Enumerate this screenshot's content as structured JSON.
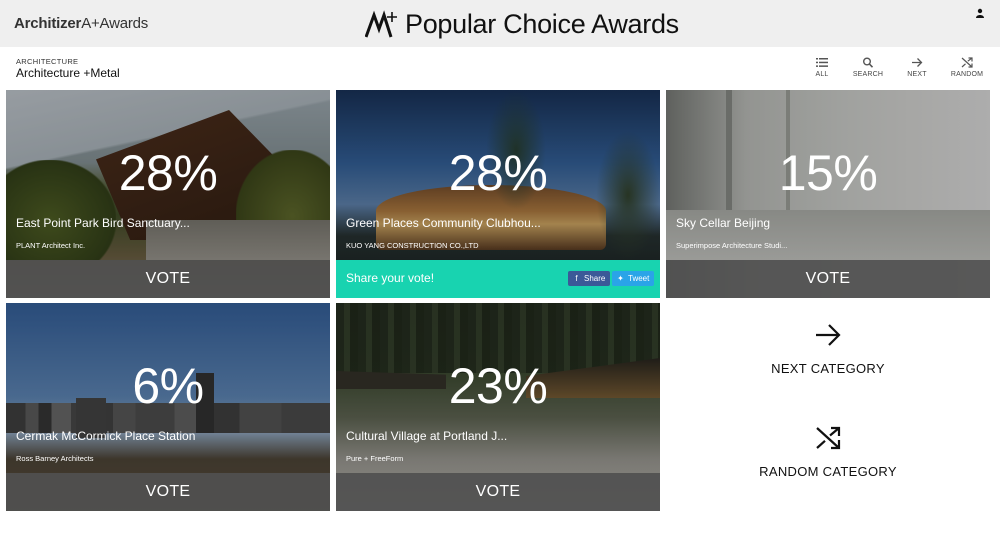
{
  "header": {
    "brand_wordmark": "Architizer",
    "brand_suffix": "A+Awards",
    "title_mark": "A+",
    "title": "Popular Choice Awards",
    "user_icon": "user-icon"
  },
  "breadcrumb": {
    "category_group": "ARCHITECTURE",
    "category": "Architecture +Metal"
  },
  "nav": {
    "all": "ALL",
    "search": "SEARCH",
    "next": "NEXT",
    "random": "RANDOM"
  },
  "projects": [
    {
      "percent": "28%",
      "name": "East Point Park Bird Sanctuary...",
      "firm": "PLANT Architect Inc.",
      "action": "VOTE"
    },
    {
      "percent": "28%",
      "name": "Green Places Community Clubhou...",
      "firm": "KUO YANG CONSTRUCTION CO.,LTD",
      "share_text": "Share your vote!",
      "share_fb": "Share",
      "share_tw": "Tweet"
    },
    {
      "percent": "15%",
      "name": "Sky Cellar Beijing",
      "firm": "Superimpose Architecture Studi...",
      "action": "VOTE"
    },
    {
      "percent": "6%",
      "name": "Cermak McCormick Place Station",
      "firm": "Ross Barney Architects",
      "action": "VOTE"
    },
    {
      "percent": "23%",
      "name": "Cultural Village at Portland J...",
      "firm": "Pure + FreeForm",
      "action": "VOTE"
    }
  ],
  "actions": {
    "next_category": "NEXT CATEGORY",
    "random_category": "RANDOM CATEGORY"
  },
  "colors": {
    "share_bar": "#18d3b0",
    "vote_bar": "#505050",
    "facebook": "#3b5998",
    "twitter": "#2aa4e8"
  }
}
